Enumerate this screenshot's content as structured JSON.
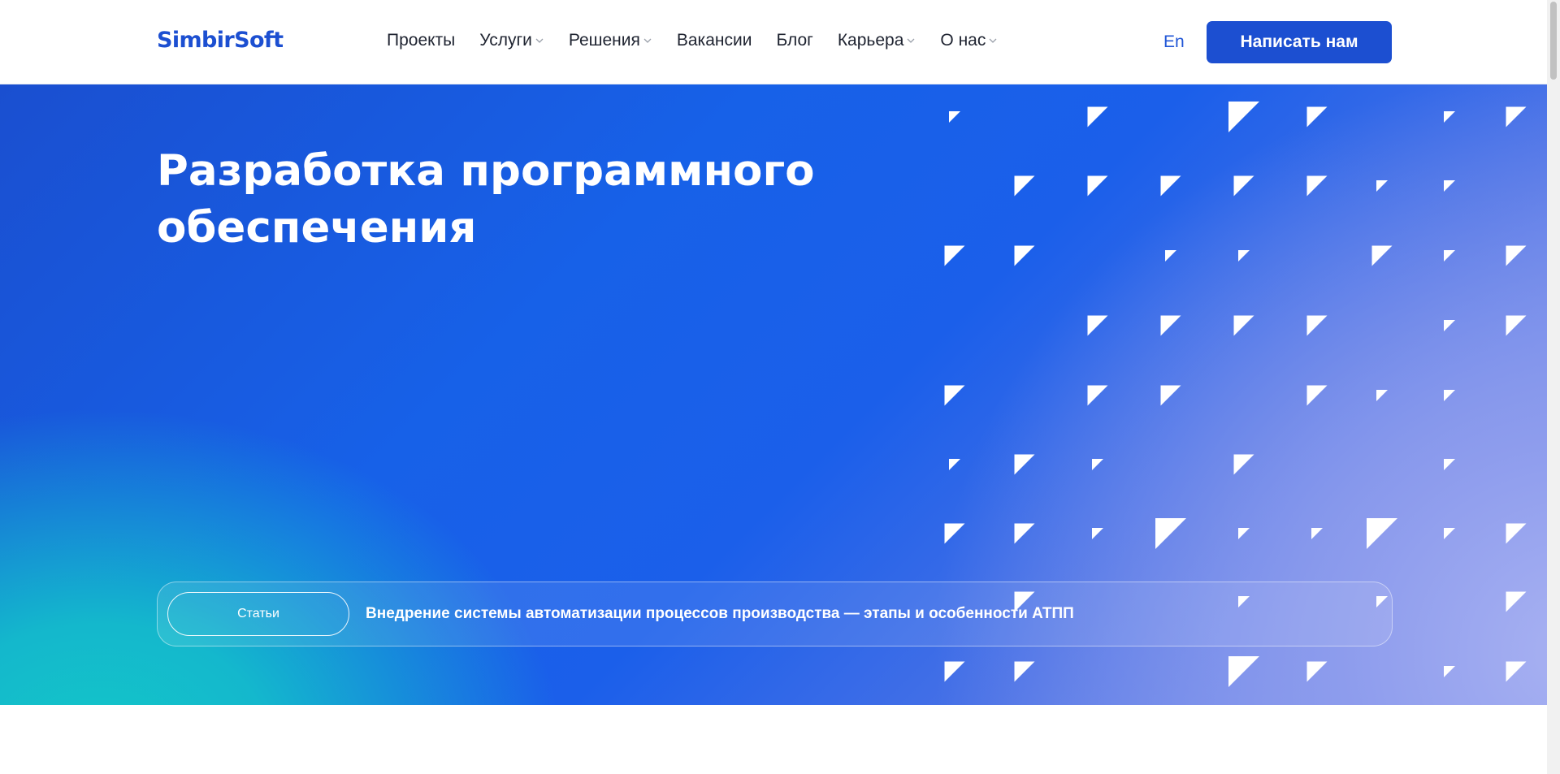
{
  "header": {
    "logo": "SimbirSoft",
    "nav": [
      {
        "label": "Проекты",
        "dropdown": false
      },
      {
        "label": "Услуги",
        "dropdown": true
      },
      {
        "label": "Решения",
        "dropdown": true
      },
      {
        "label": "Вакансии",
        "dropdown": false
      },
      {
        "label": "Блог",
        "dropdown": false
      },
      {
        "label": "Карьера",
        "dropdown": true
      },
      {
        "label": "О нас",
        "dropdown": true
      }
    ],
    "lang": "En",
    "cta": "Написать нам"
  },
  "hero": {
    "title_line1": "Разработка программного",
    "title_line2": "обеспечения",
    "news": {
      "tag": "Статьи",
      "text": "Внедрение системы автоматизации процессов производства — этапы и особенности АТПП"
    }
  },
  "colors": {
    "brand": "#1c4fd1",
    "hero_blue": "#1761e8",
    "hero_teal": "#13c7c8",
    "hero_lavender": "#8d9ced"
  }
}
